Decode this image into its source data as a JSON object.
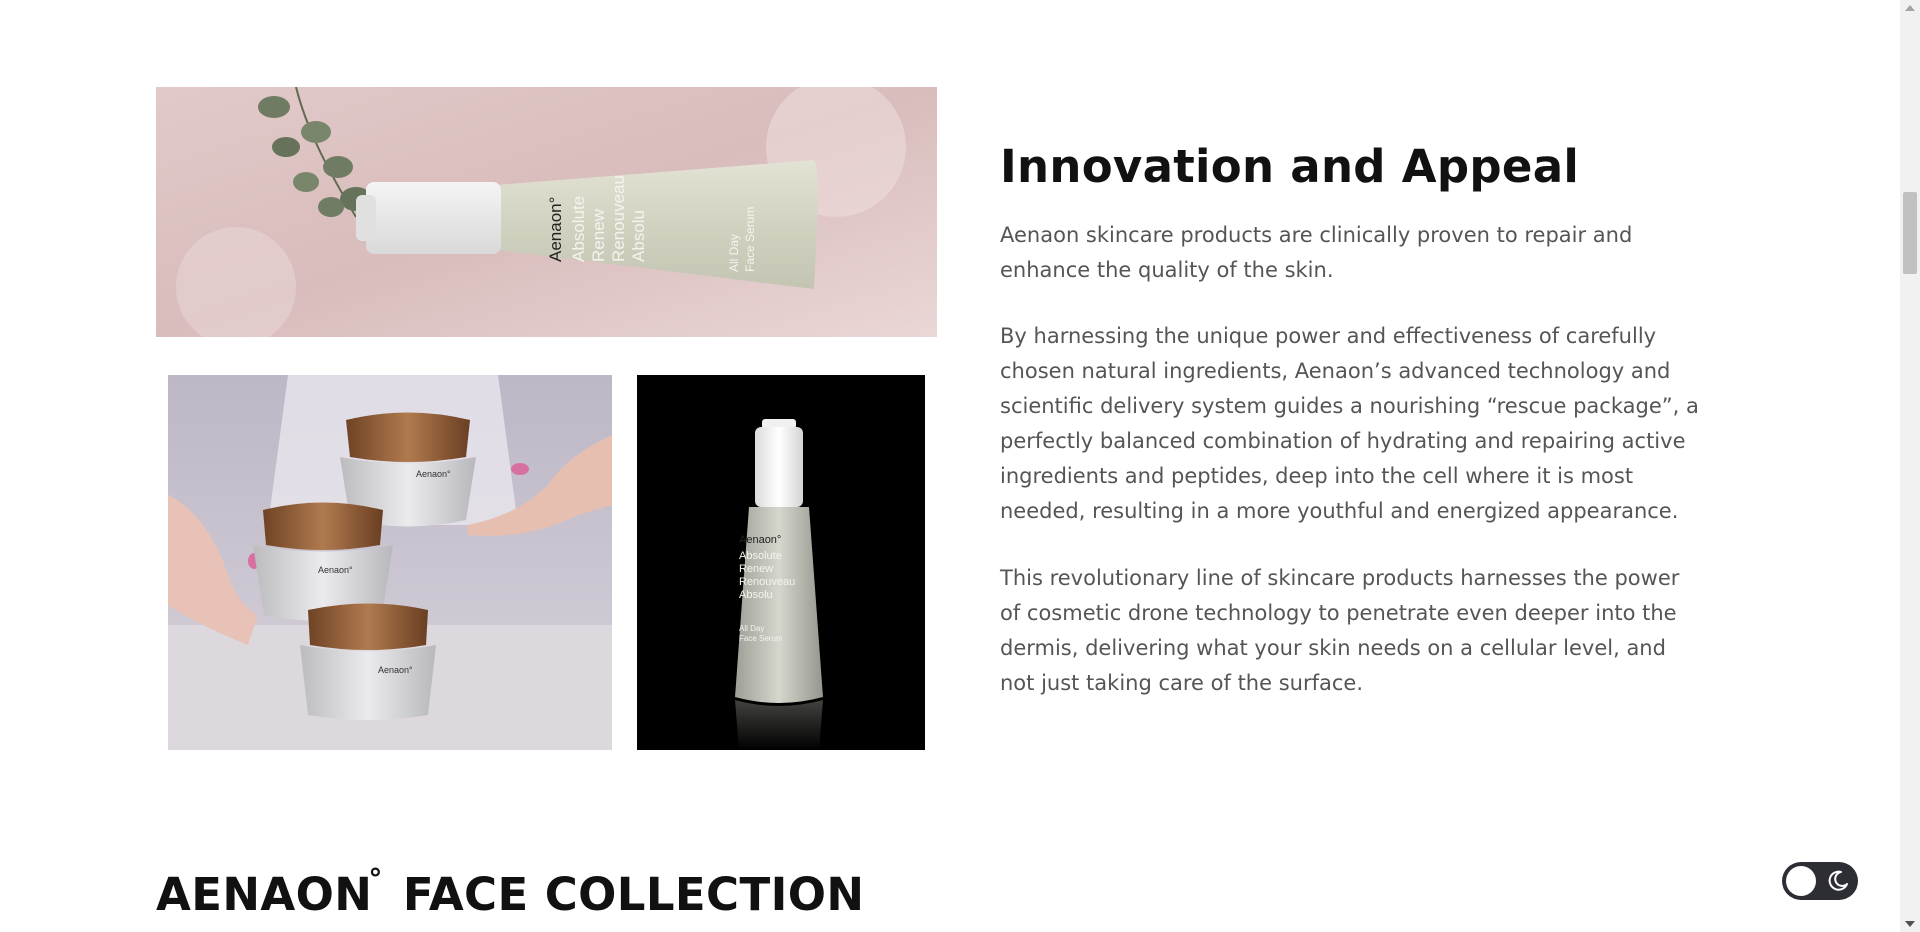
{
  "section": {
    "heading": "Innovation and Appeal",
    "paragraphs": [
      "Aenaon skincare products are clinically proven to repair and enhance the quality of the skin.",
      "By harnessing the unique power and effectiveness of carefully chosen natural ingredients, Aenaon’s advanced technology and scientific delivery system guides a nourishing “rescue package”, a perfectly balanced combination of hydrating and repairing active ingredients and peptides, deep into the cell where it is most needed, resulting in a more youthful and energized appearance.",
      "This revolutionary line of skincare products harnesses the power of cosmetic drone technology to penetrate even deeper into the dermis, delivering what your skin needs on a cellular level, and not just taking care of the surface."
    ]
  },
  "collection": {
    "brand": "AENAON",
    "degree": "°",
    "rest": "FACE COLLECTION"
  },
  "images": {
    "top_bottle": {
      "brand": "Aenaon°",
      "lines": [
        "Absolute",
        "Renew",
        "Renouveau",
        "Absolu"
      ],
      "sub": [
        "All Day",
        "Face Serum"
      ]
    },
    "jars": {
      "brand": "Aenaon°"
    },
    "serum": {
      "brand": "Aenaon°",
      "lines": [
        "Absolute",
        "Renew",
        "Renouveau",
        "Absolu"
      ],
      "sub": [
        "All Day",
        "Face Serum"
      ]
    }
  },
  "theme_toggle": {
    "icon_left": "sun-circle-icon",
    "icon_right": "moon-icon"
  },
  "colors": {
    "heading": "#111111",
    "body_text": "#555555",
    "toggle_bg": "#2d2d34"
  }
}
